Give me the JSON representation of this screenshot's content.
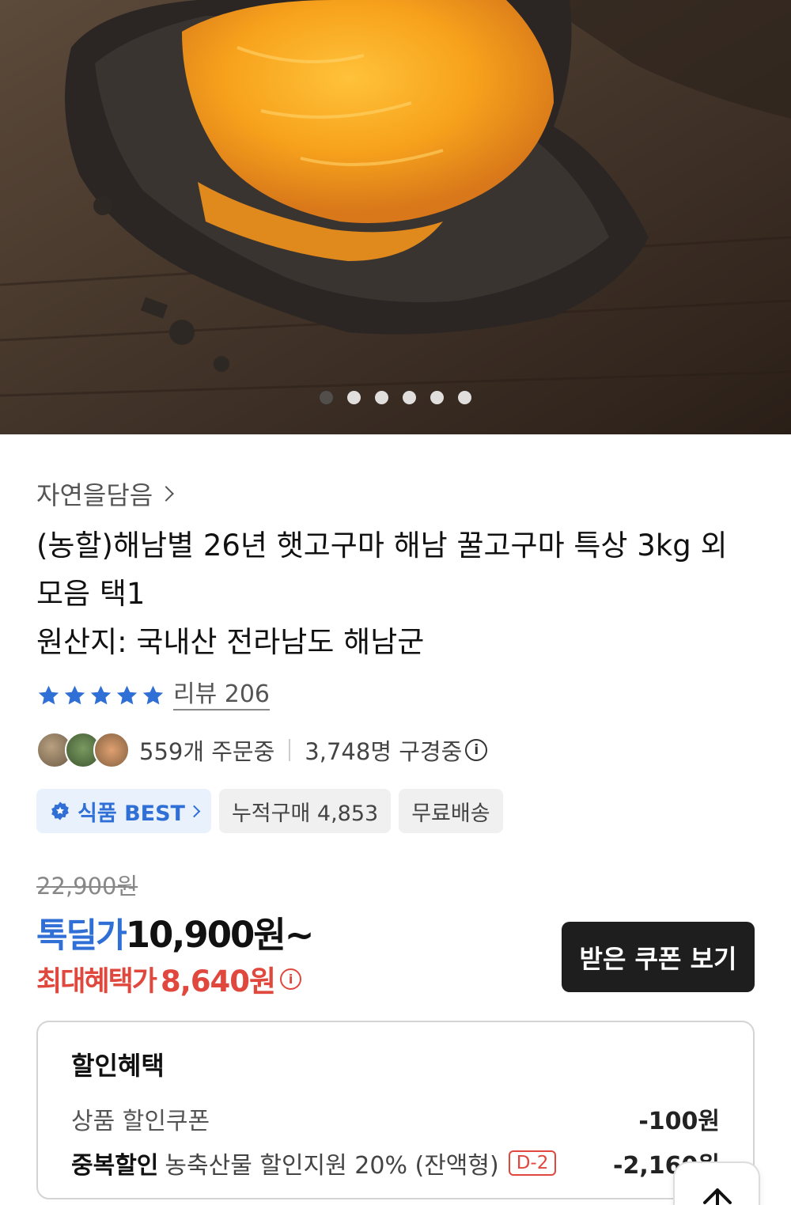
{
  "carousel": {
    "slide_count": 6,
    "active_index": 0
  },
  "product": {
    "seller": "자연을담음",
    "title_line1": "(농할)해남별 26년 햇고구마 해남 꿀고구마 특상 3kg 외",
    "title_line2": "모음 택1",
    "origin": "원산지: 국내산 전라남도 해남군",
    "rating_stars": 5,
    "review_label": "리뷰 206",
    "ordering": "559개 주문중",
    "browsing": "3,748명 구경중"
  },
  "chips": {
    "best": "식품 BEST",
    "cumulative": "누적구매 4,853",
    "shipping": "무료배송"
  },
  "price": {
    "original": "22,900원",
    "deal_label": "톡딜가",
    "deal_price": "10,900원~",
    "max_label": "최대혜택가",
    "max_price": "8,640원"
  },
  "coupon_button": "받은 쿠폰 보기",
  "discount": {
    "title": "할인혜택",
    "row1_label": "상품 할인쿠폰",
    "row1_amount": "-100원",
    "row2_label": "중복할인",
    "row2_desc": "농축산물 할인지원 20% (잔액형)",
    "row2_badge": "D-2",
    "row2_amount": "-2,160원"
  },
  "colors": {
    "accent_blue": "#2f6fd6",
    "accent_red": "#e0483e",
    "button_dark": "#1e1e1e"
  },
  "icons": [
    "chevron-right-icon",
    "star-icon",
    "info-icon",
    "best-badge-icon",
    "arrow-up-icon"
  ]
}
